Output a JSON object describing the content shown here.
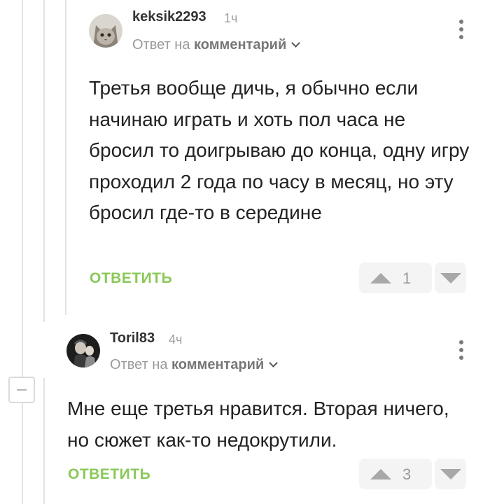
{
  "comments": [
    {
      "username": "keksik2293",
      "time": "1ч",
      "reply_prefix": "Ответ на",
      "reply_target": "комментарий",
      "text": "Третья вообще дичь, я обычно если начинаю играть и хоть пол часа не бросил то доигрываю до конца, одну игру проходил 2 года по часу в месяц, но эту бросил где-то в середине",
      "reply_label": "ОТВЕТИТЬ",
      "rating": "1"
    },
    {
      "username": "Toril83",
      "time": "4ч",
      "reply_prefix": "Ответ на",
      "reply_target": "комментарий",
      "text": "Мне еще третья нравится. Вторая ничего, но сюжет как-то недокрутили.",
      "reply_label": "ОТВЕТИТЬ",
      "rating": "3"
    }
  ],
  "colors": {
    "accent_green": "#8ac858",
    "muted_gray": "#9a9a9a"
  }
}
